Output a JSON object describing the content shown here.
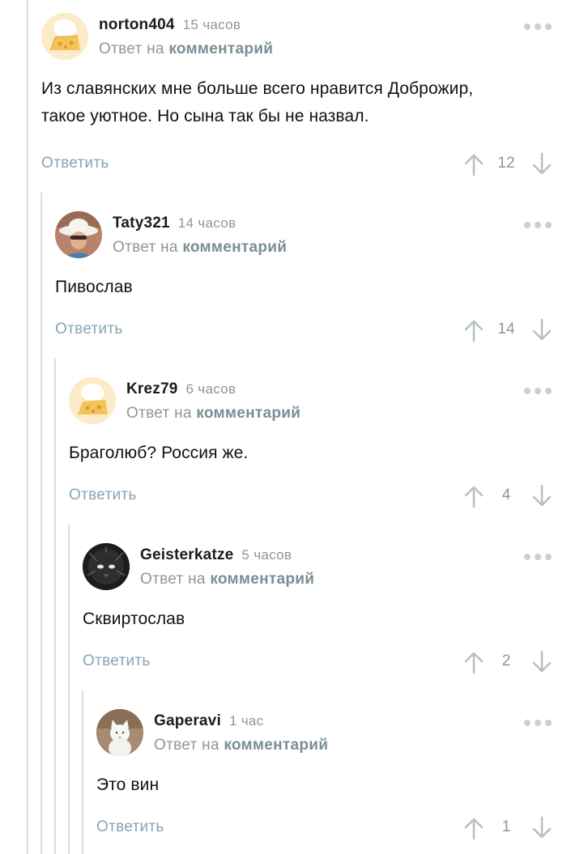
{
  "reply_prefix": "Ответ на",
  "reply_link": "комментарий",
  "answer_label": "Ответить",
  "comments": [
    {
      "username": "norton404",
      "time": "15 часов",
      "text": "Из славянских мне больше всего нравится Доброжир,\nтакое уютное. Но сына так бы не назвал.",
      "votes": "12",
      "avatar_icon": "chef-cheese-avatar"
    },
    {
      "username": "Taty321",
      "time": "14 часов",
      "text": "Пивослав",
      "votes": "14",
      "avatar_icon": "photo-avatar"
    },
    {
      "username": "Krez79",
      "time": "6 часов",
      "text": "Браголюб? Россия же.",
      "votes": "4",
      "avatar_icon": "chef-cheese-avatar"
    },
    {
      "username": "Geisterkatze",
      "time": "5 часов",
      "text": "Сквиртослав",
      "votes": "2",
      "avatar_icon": "black-cat-avatar"
    },
    {
      "username": "Gaperavi",
      "time": "1 час",
      "text": "Это вин",
      "votes": "1",
      "avatar_icon": "white-cat-avatar"
    }
  ],
  "colors": {
    "accent": "#87a4b3",
    "muted": "#8e959b",
    "thread_line": "#dedede"
  }
}
